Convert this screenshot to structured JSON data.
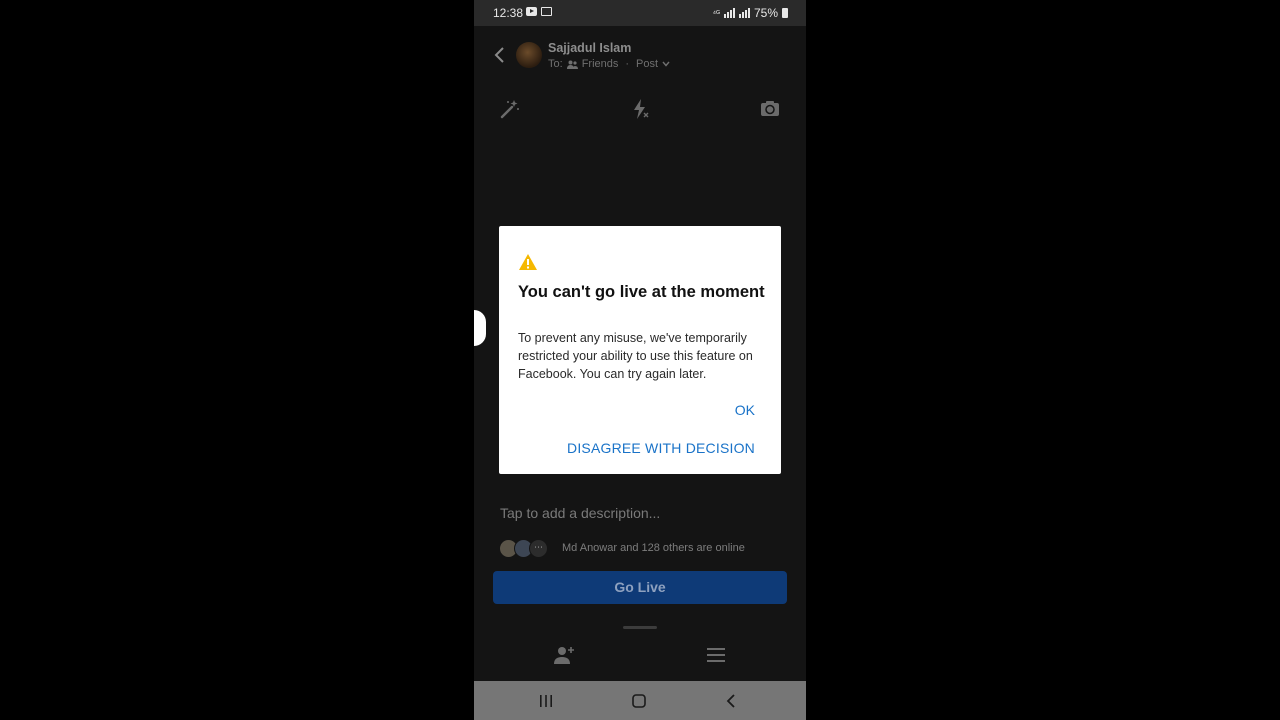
{
  "status_bar": {
    "time": "12:38",
    "battery": "75%",
    "icons": [
      "youtube-icon",
      "cast-icon",
      "wifi-calling-icon",
      "signal-icon",
      "battery-icon"
    ]
  },
  "header": {
    "name": "Sajjadul Islam",
    "to_label": "To:",
    "audience": "Friends",
    "post_type": "Post"
  },
  "toolbar": {
    "icons": [
      "magic-wand-icon",
      "flash-off-icon",
      "switch-camera-icon"
    ]
  },
  "dialog": {
    "title": "You can't go live at the moment",
    "body": "To prevent any misuse, we've temporarily restricted your ability to use this feature on Facebook. You can try again later.",
    "ok_label": "OK",
    "disagree_label": "DISAGREE WITH DECISION",
    "warning_color": "#f5b800",
    "action_color": "#1a73c8"
  },
  "composer": {
    "description_placeholder": "Tap to add a description...",
    "online_text": "Md Anowar and 128 others are online",
    "go_live_label": "Go Live"
  },
  "bottom_actions": {
    "icons": [
      "add-person-icon",
      "menu-icon"
    ]
  },
  "nav_bar": {
    "icons": [
      "recents-icon",
      "home-icon",
      "back-icon"
    ]
  }
}
